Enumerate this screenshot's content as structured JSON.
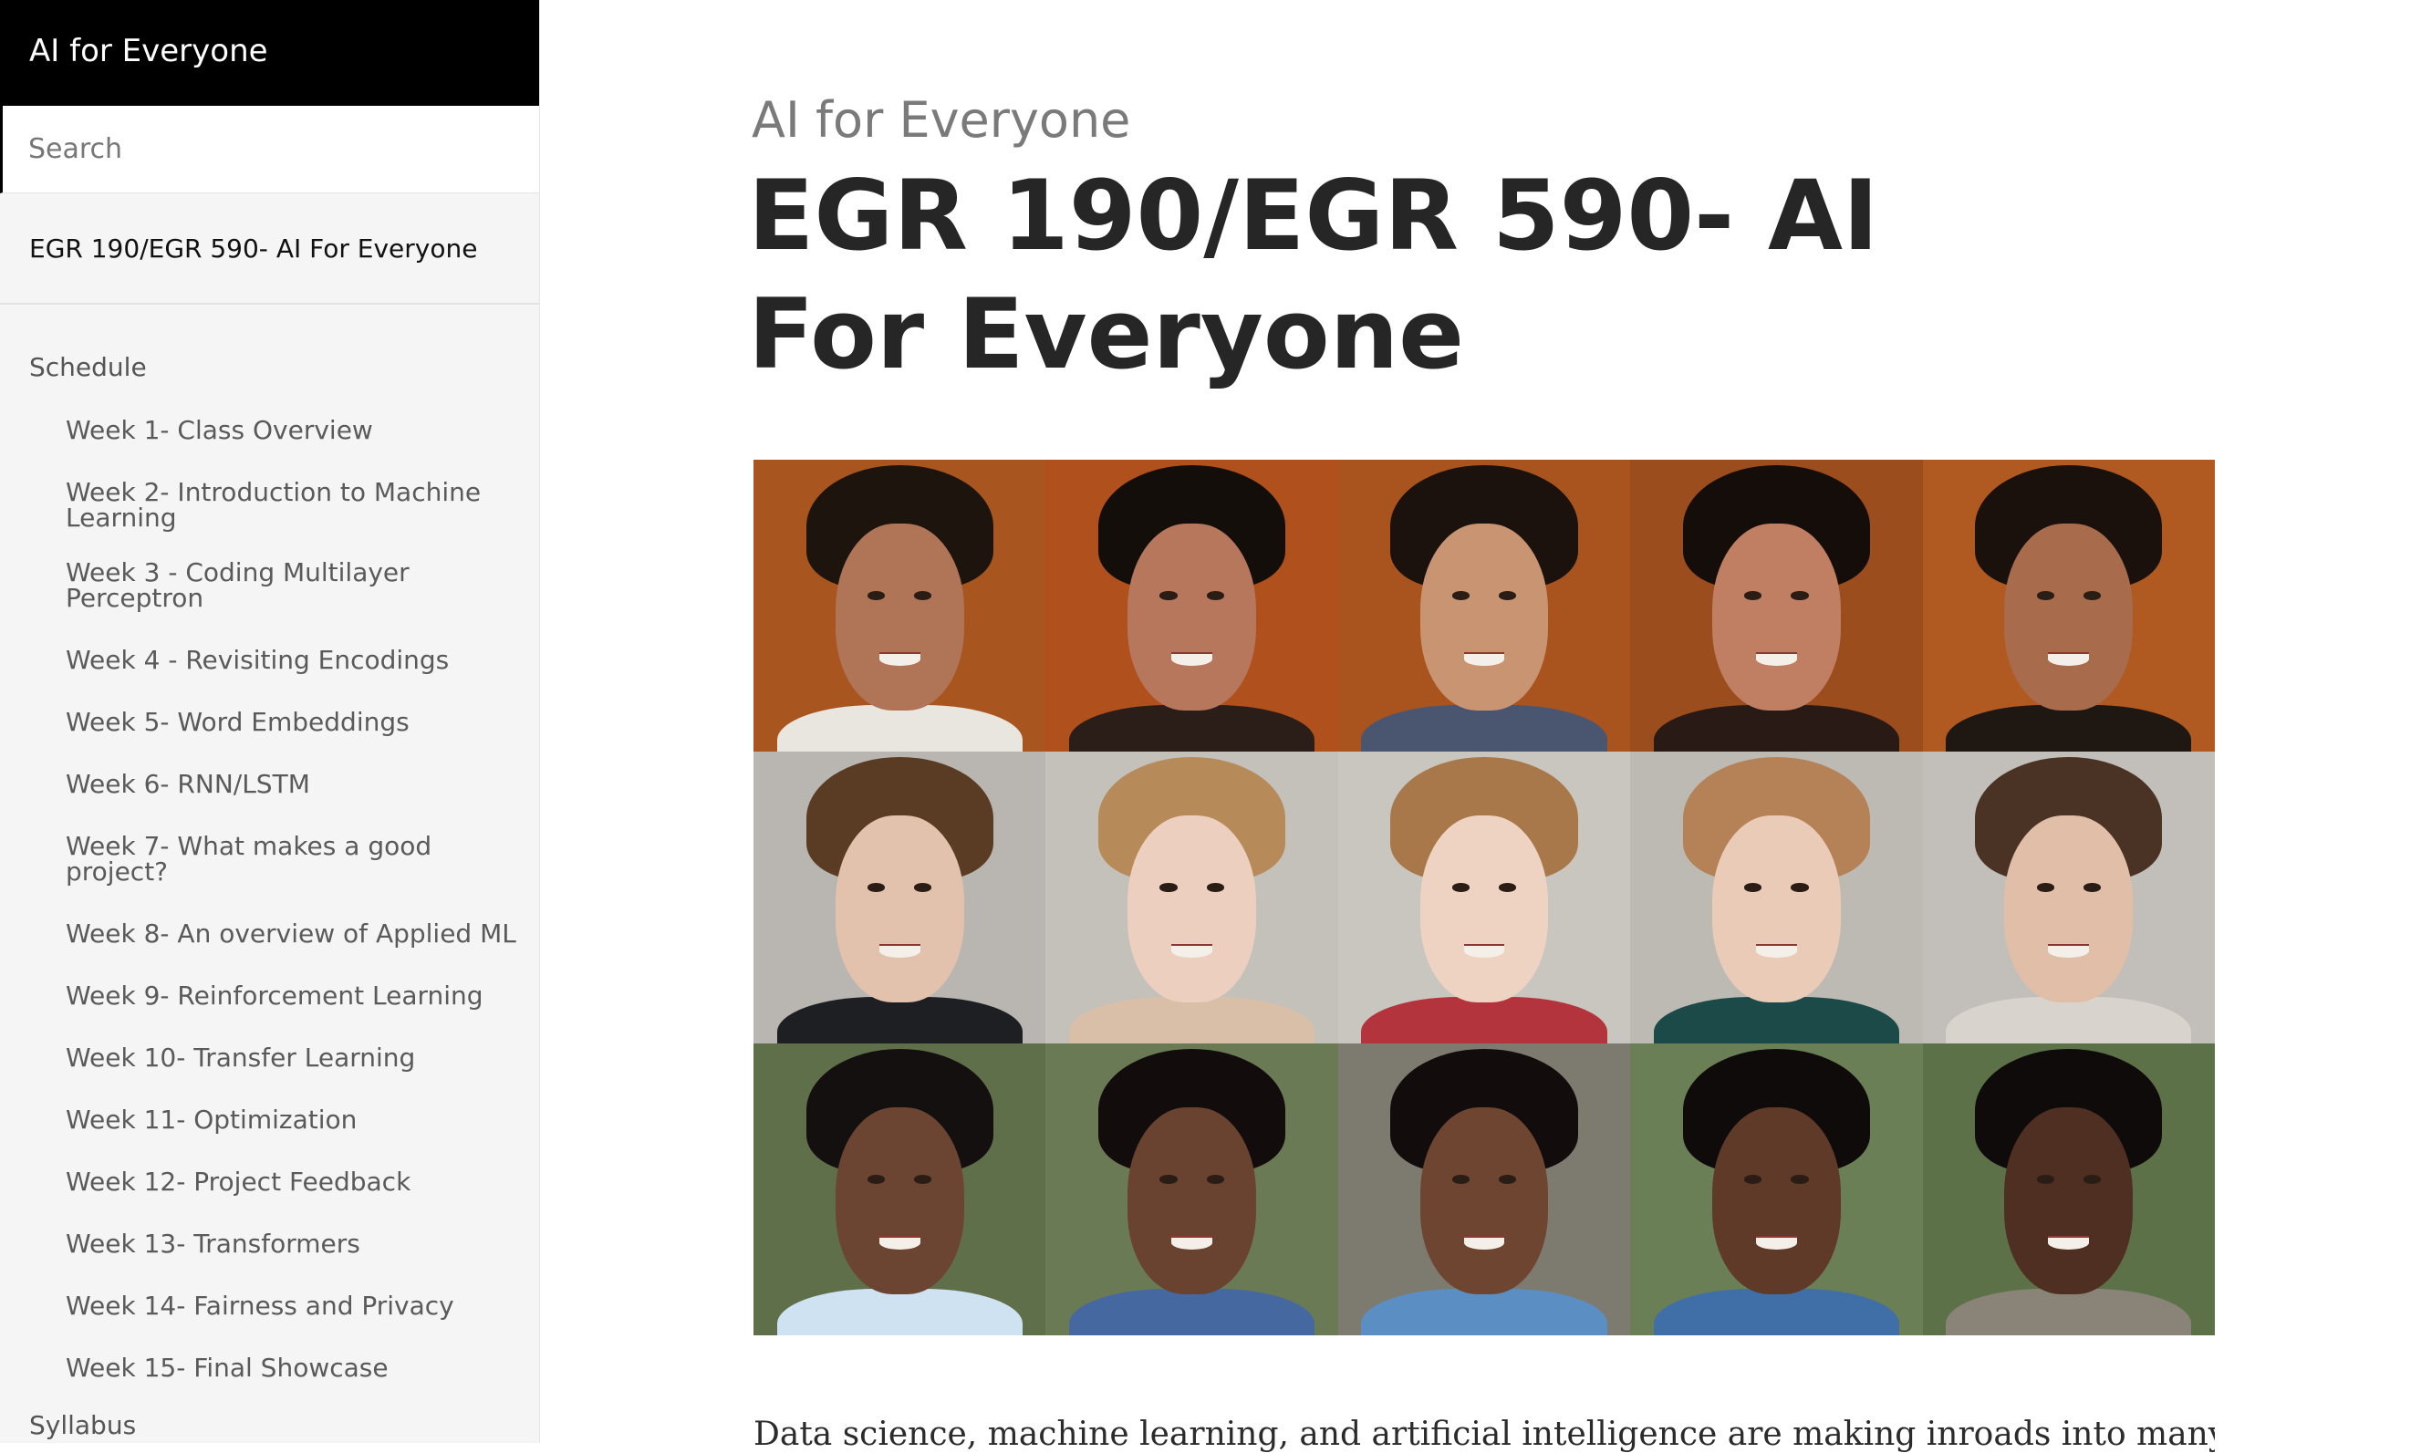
{
  "sidebar": {
    "site_title": "AI for Everyone",
    "search_placeholder": "Search",
    "home_link": "EGR 190/EGR 590- AI For Everyone",
    "schedule_label": "Schedule",
    "weeks": [
      "Week 1- Class Overview",
      "Week 2- Introduction to Machine Learning",
      "Week 3 - Coding Multilayer Perceptron",
      "Week 4 - Revisiting Encodings",
      "Week 5- Word Embeddings",
      "Week 6- RNN/LSTM",
      "Week 7- What makes a good project?",
      "Week 8- An overview of Applied ML",
      "Week 9- Reinforcement Learning",
      "Week 10- Transfer Learning",
      "Week 11- Optimization",
      "Week 12- Project Feedback",
      "Week 13- Transformers",
      "Week 14- Fairness and Privacy",
      "Week 15- Final Showcase"
    ],
    "syllabus_label": "Syllabus"
  },
  "main": {
    "subtitle": "AI for Everyone",
    "title": "EGR 190/EGR 590- AI For Everyone",
    "intro_text": "Data science, machine learning, and artificial intelligence are making inroads into many"
  },
  "hero_image": {
    "rows": [
      [
        {
          "bg": "#a8551f",
          "skin": "#b07556",
          "hair": "#1e140e",
          "body": "#e9e6e0"
        },
        {
          "bg": "#b0501c",
          "skin": "#b7775c",
          "hair": "#140e0b",
          "body": "#2b1e18"
        },
        {
          "bg": "#a9541e",
          "skin": "#c89472",
          "hair": "#1b120d",
          "body": "#4a5670"
        },
        {
          "bg": "#9c4d1d",
          "skin": "#c07e63",
          "hair": "#140d0a",
          "body": "#2a1a16"
        },
        {
          "bg": "#b05a22",
          "skin": "#a86b4c",
          "hair": "#1a110c",
          "body": "#1f1712"
        }
      ],
      [
        {
          "bg": "#b9b6b1",
          "skin": "#e3c2ad",
          "hair": "#5a3b24",
          "body": "#1e1f22"
        },
        {
          "bg": "#c4c0ba",
          "skin": "#eccfbf",
          "hair": "#b78a5a",
          "body": "#d9bfa8"
        },
        {
          "bg": "#c9c5bf",
          "skin": "#efd3c2",
          "hair": "#a8784a",
          "body": "#b3343c"
        },
        {
          "bg": "#bdbab4",
          "skin": "#eacbb7",
          "hair": "#b58257",
          "body": "#1c4a48"
        },
        {
          "bg": "#c2bfba",
          "skin": "#e1bea8",
          "hair": "#4a3324",
          "body": "#d8d3cc"
        }
      ],
      [
        {
          "bg": "#5f6f4a",
          "skin": "#6b4531",
          "hair": "#151010",
          "body": "#cfe2f2"
        },
        {
          "bg": "#6a7a55",
          "skin": "#6a4230",
          "hair": "#120d0c",
          "body": "#4668a0"
        },
        {
          "bg": "#7d7a70",
          "skin": "#6e4530",
          "hair": "#120d0c",
          "body": "#5b8fc4"
        },
        {
          "bg": "#6b7f57",
          "skin": "#5f3a28",
          "hair": "#0f0b0b",
          "body": "#3f6fa6"
        },
        {
          "bg": "#5d7148",
          "skin": "#4e2f21",
          "hair": "#0f0b0a",
          "body": "#8a8478"
        }
      ]
    ]
  },
  "colors": {
    "sidebar_bg": "#f5f5f5",
    "header_bg": "#000000",
    "title_color": "#262626",
    "subtitle_color": "#7a7a7a"
  }
}
